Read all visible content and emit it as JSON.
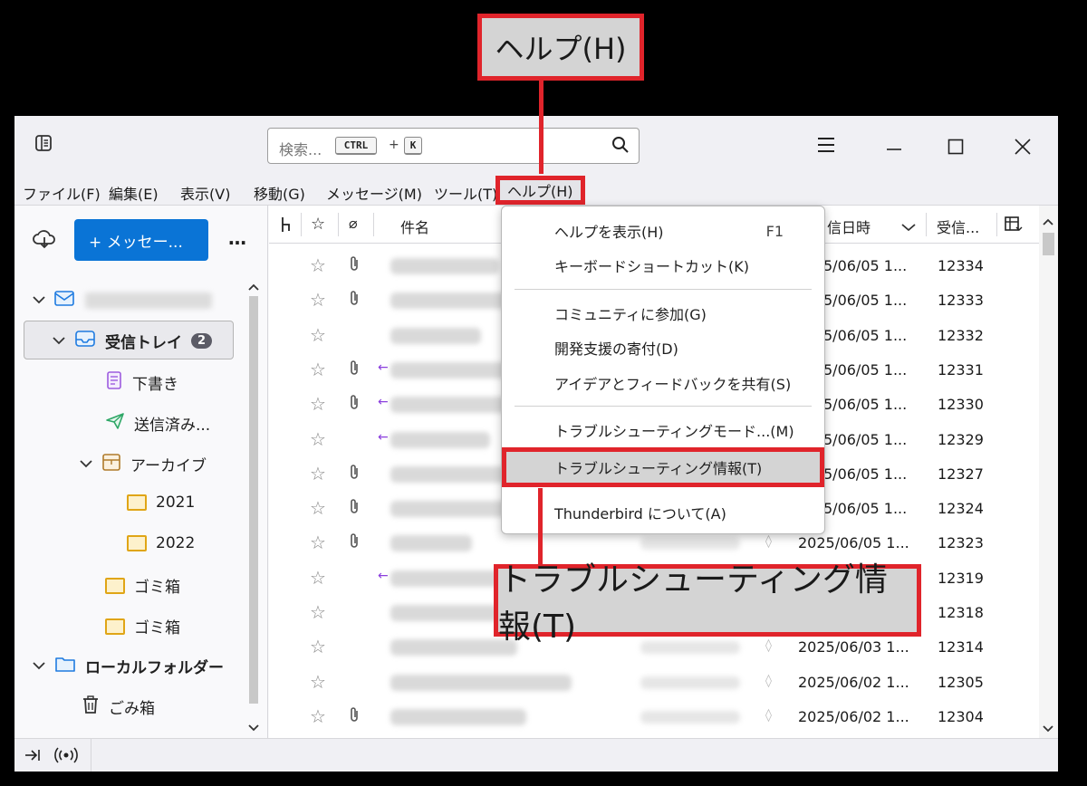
{
  "callouts": {
    "top": "ヘルプ(H)",
    "bottom": "トラブルシューティング情報(T)"
  },
  "toolbar": {
    "search_placeholder": "検索...",
    "shortcut_mod": "CTRL",
    "shortcut_plus": "+",
    "shortcut_key": "K",
    "icons": [
      "sidebar-icon",
      "search-icon",
      "hamburger-icon",
      "minimize-icon",
      "maximize-icon",
      "close-icon"
    ]
  },
  "menubar": {
    "file": "ファイル(F)",
    "edit": "編集(E)",
    "view": "表示(V)",
    "go": "移動(G)",
    "message": "メッセージ(M)",
    "tools": "ツール(T)",
    "help": "ヘルプ(H)"
  },
  "folderpane": {
    "new_message": "+ メッセー...",
    "more": "…",
    "inbox": "受信トレイ",
    "inbox_count": "2",
    "drafts": "下書き",
    "sent": "送信済み...",
    "archive": "アーカイブ",
    "y2021": "2021",
    "y2022": "2022",
    "trash1": "ゴミ箱",
    "trash2": "ゴミ箱",
    "local_folders": "ローカルフォルダー",
    "local_trash": "ごみ箱"
  },
  "columns": {
    "subject": "件名",
    "date": "信日時",
    "received": "受信..."
  },
  "help_menu": {
    "show_help": "ヘルプを表示(H)",
    "show_help_key": "F1",
    "shortcuts": "キーボードショートカット(K)",
    "community": "コミュニティに参加(G)",
    "donate": "開発支援の寄付(D)",
    "feedback": "アイデアとフィードバックを共有(S)",
    "troubleshoot_mode": "トラブルシューティングモード...(M)",
    "troubleshoot_info": "トラブルシューティング情報(T)",
    "about": "Thunderbird について(A)"
  },
  "messages": [
    {
      "date": "5/06/05 1...",
      "num": "12334",
      "attach": true,
      "reply": false
    },
    {
      "date": "5/06/05 1...",
      "num": "12333",
      "attach": true,
      "reply": false
    },
    {
      "date": "5/06/05 1...",
      "num": "12332",
      "attach": false,
      "reply": false
    },
    {
      "date": "5/06/05 1...",
      "num": "12331",
      "attach": true,
      "reply": true
    },
    {
      "date": "5/06/05 1...",
      "num": "12330",
      "attach": true,
      "reply": true
    },
    {
      "date": "5/06/05 1...",
      "num": "12329",
      "attach": false,
      "reply": true
    },
    {
      "date": "5/06/05 1...",
      "num": "12327",
      "attach": true,
      "reply": false
    },
    {
      "date": "5/06/05 1...",
      "num": "12324",
      "attach": true,
      "reply": false
    },
    {
      "date": "2025/06/05 1...",
      "num": "12323",
      "attach": true,
      "reply": false
    },
    {
      "date": "",
      "num": "12319",
      "attach": false,
      "reply": true
    },
    {
      "date": "",
      "num": "12318",
      "attach": false,
      "reply": false
    },
    {
      "date": "2025/06/03 1...",
      "num": "12314",
      "attach": false,
      "reply": false
    },
    {
      "date": "2025/06/02 1...",
      "num": "12305",
      "attach": false,
      "reply": false
    },
    {
      "date": "2025/06/02 1...",
      "num": "12304",
      "attach": true,
      "reply": false
    }
  ]
}
